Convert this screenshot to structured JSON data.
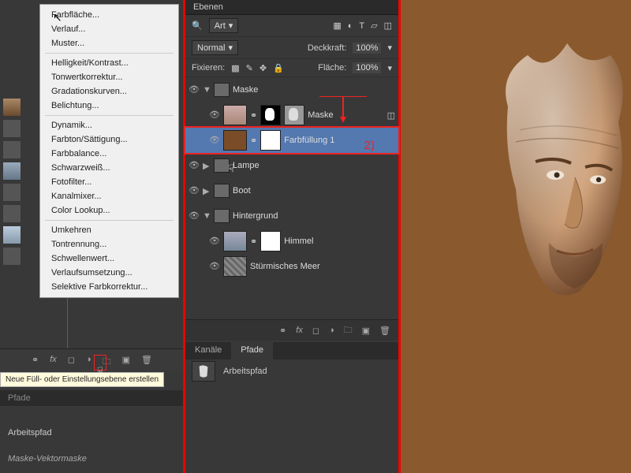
{
  "menu": {
    "items": [
      "Farbfläche...",
      "Verlauf...",
      "Muster..."
    ],
    "group2": [
      "Helligkeit/Kontrast...",
      "Tonwertkorrektur...",
      "Gradationskurven...",
      "Belichtung..."
    ],
    "group3": [
      "Dynamik...",
      "Farbton/Sättigung...",
      "Farbbalance...",
      "Schwarzweiß...",
      "Fotofilter...",
      "Kanalmixer...",
      "Color Lookup..."
    ],
    "group4": [
      "Umkehren",
      "Tontrennung...",
      "Schwellenwert...",
      "Verlaufsumsetzung...",
      "Selektive Farbkorrektur..."
    ]
  },
  "annot": {
    "one": "1)",
    "two": "2)"
  },
  "fxbar_tip": "Neue Füll- oder Einstellungsebene erstellen",
  "tab1": "Pfade",
  "path1": "Arbeitspfad",
  "maskpath": "Maske-Vektormaske",
  "panel2": {
    "title": "Ebenen",
    "kind": "Art",
    "blend": "Normal",
    "opacity_lbl": "Deckkraft:",
    "opacity": "100%",
    "lock_lbl": "Fixieren:",
    "fill_lbl": "Fläche:",
    "fill": "100%"
  },
  "layers": {
    "g1": "Maske",
    "l1": "Maske",
    "l2": "Farbfüllung 1",
    "l3": "Lampe",
    "l4": "Boot",
    "g2": "Hintergrund",
    "l5": "Himmel",
    "l6": "Stürmisches Meer"
  },
  "tabs2": {
    "a": "Kanäle",
    "b": "Pfade"
  },
  "path2": "Arbeitspfad"
}
